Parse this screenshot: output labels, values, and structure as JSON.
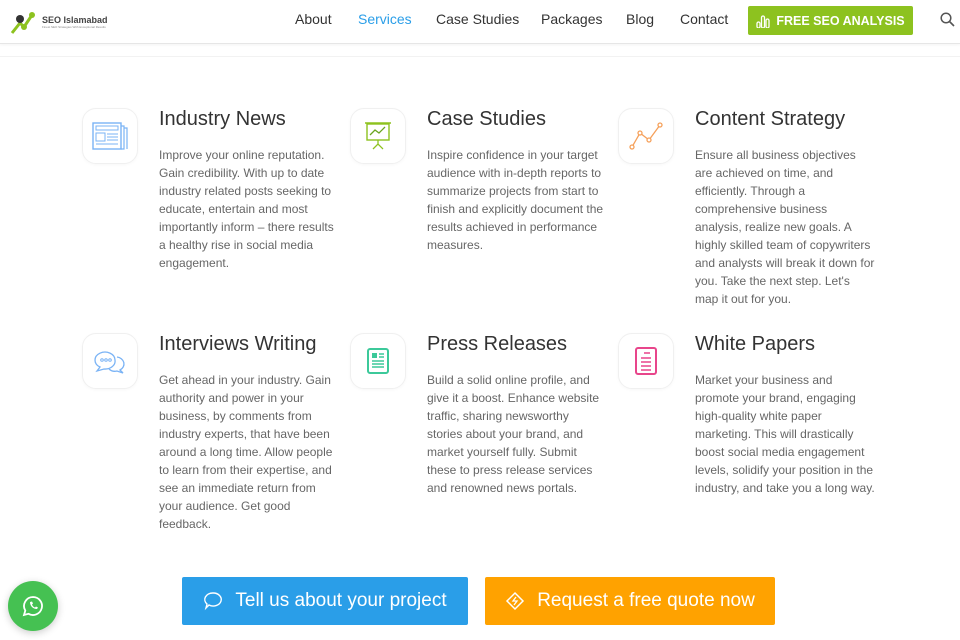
{
  "header": {
    "logo": {
      "name": "SEO Islamabad",
      "tagline": "Finest SEO Strategies With Exceptional Results"
    },
    "nav": [
      {
        "label": "About"
      },
      {
        "label": "Services",
        "active": true
      },
      {
        "label": "Case Studies"
      },
      {
        "label": "Packages"
      },
      {
        "label": "Blog"
      },
      {
        "label": "Contact"
      }
    ],
    "cta_label": "FREE SEO ANALYSIS",
    "colors": {
      "active": "#2a9ee8",
      "cta": "#8dc21f"
    }
  },
  "services": [
    {
      "title": "Industry News",
      "icon": "newspaper-icon",
      "text": "Improve your online reputation. Gain credibility. With up to date industry related posts seeking to educate, entertain and most importantly inform – there results a healthy rise in social media engagement."
    },
    {
      "title": "Case Studies",
      "icon": "presentation-chart-icon",
      "text": "Inspire confidence in your target audience with in-depth reports to summarize projects from start to finish and explicitly document the results achieved in performance measures."
    },
    {
      "title": "Content Strategy",
      "icon": "line-graph-icon",
      "text": "Ensure all business objectives are achieved on time, and efficiently. Through a comprehensive business analysis, realize new goals. A highly skilled team of copywriters and analysts will break it down for you. Take the next step. Let's map it out for you."
    },
    {
      "title": "Interviews Writing",
      "icon": "chat-bubbles-icon",
      "text": "Get ahead in your industry. Gain authority and power in your business, by comments from industry experts, that have been around a long time. Allow people to learn from their expertise, and see an immediate return from your audience. Get good feedback."
    },
    {
      "title": "Press Releases",
      "icon": "press-document-icon",
      "text": "Build a solid online profile, and give it a boost. Enhance website traffic, sharing newsworthy stories about your brand, and market yourself fully. Submit these to press release services and renowned news portals."
    },
    {
      "title": "White Papers",
      "icon": "paper-document-icon",
      "text": "Market your business and promote your brand, engaging high-quality white paper marketing. This will drastically boost social media engagement levels, solidify your position in the industry, and take you a long way."
    }
  ],
  "buttons": {
    "project": "Tell us about your project",
    "quote": "Request a free quote now",
    "colors": {
      "project": "#2a9ee8",
      "quote": "#ffa200",
      "whatsapp": "#45c152"
    }
  }
}
